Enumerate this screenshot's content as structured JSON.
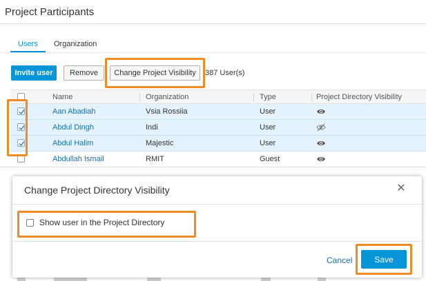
{
  "page": {
    "title": "Project Participants"
  },
  "tabs": [
    {
      "label": "Users",
      "active": true
    },
    {
      "label": "Organization",
      "active": false
    }
  ],
  "toolbar": {
    "invite_label": "Invite user",
    "remove_label": "Remove",
    "visibility_label": "Change Project Visibility",
    "user_count": "387 User(s)"
  },
  "table": {
    "columns": [
      "Name",
      "Organization",
      "Type",
      "Project Directory Visibility"
    ],
    "rows": [
      {
        "name": "Aan Abadiah",
        "organization": "Vsia Rossiia",
        "type": "User",
        "visibility": "eye-icon",
        "checked": true
      },
      {
        "name": "Abdul Dingh",
        "organization": "Indi",
        "type": "User",
        "visibility": "eye-off-icon",
        "checked": true
      },
      {
        "name": "Abdul Halim",
        "organization": "Majestic",
        "type": "User",
        "visibility": "eye-icon",
        "checked": true
      },
      {
        "name": "Abdullah Ismail",
        "organization": "RMIT",
        "type": "Guest",
        "visibility": "eye-icon",
        "checked": false
      }
    ]
  },
  "dialog": {
    "title": "Change Project Directory Visibility",
    "checkbox_label": "Show user in the Project Directory",
    "checkbox_checked": false,
    "cancel_label": "Cancel",
    "save_label": "Save"
  },
  "colors": {
    "accent": "#0696d7",
    "highlight": "#f08a24",
    "selected_row": "#e3f2fc",
    "link": "#1a6fae"
  }
}
